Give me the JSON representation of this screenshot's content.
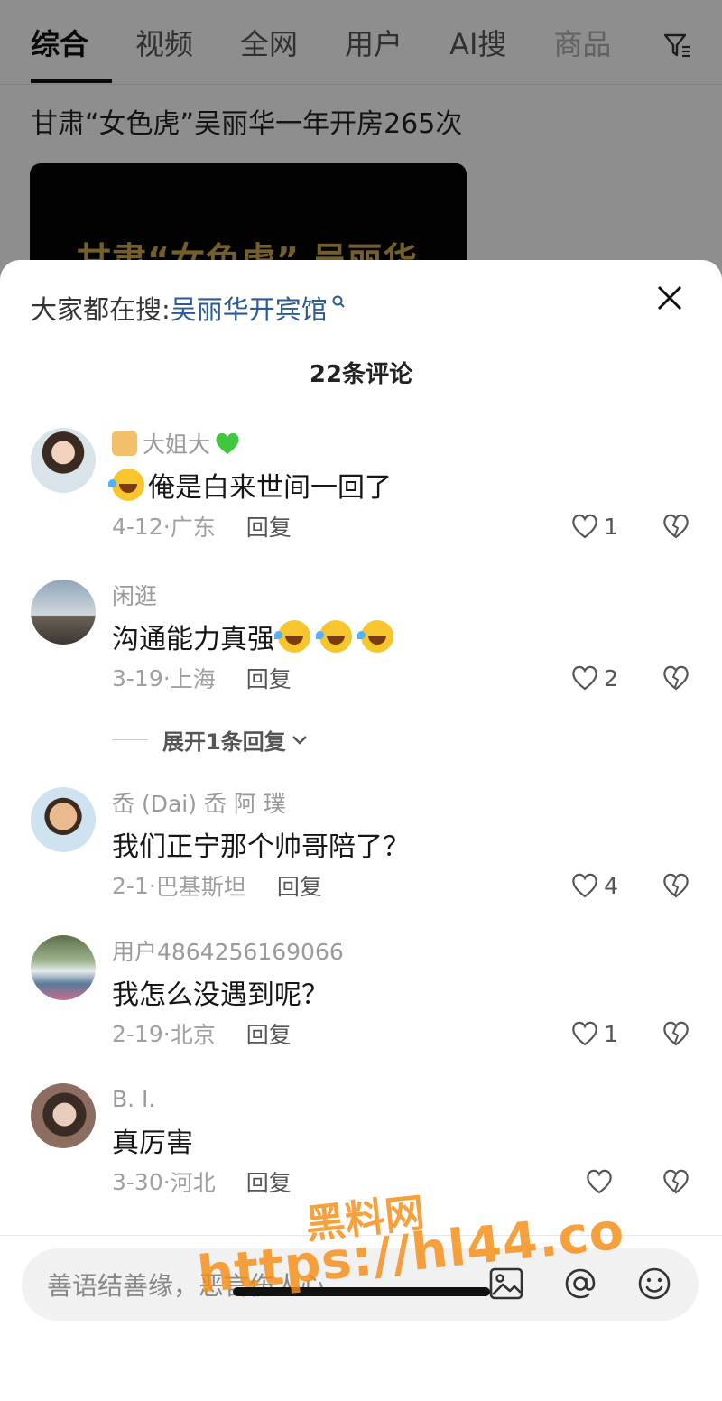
{
  "tabs": [
    {
      "label": "综合",
      "active": true
    },
    {
      "label": "视频"
    },
    {
      "label": "全网"
    },
    {
      "label": "用户"
    },
    {
      "label": "AI搜"
    },
    {
      "label": "商品"
    }
  ],
  "background": {
    "title": "甘肃“女色虎”吴丽华一年开房265次",
    "video_caption": "甘肃“女色虎” 吴丽华"
  },
  "sheet": {
    "trending_prefix": "大家都在搜:",
    "trending_query": "吴丽华开宾馆",
    "comment_count": "22条评论",
    "comments": [
      {
        "user": "大姐大",
        "text": "俺是白来世间一回了",
        "emoji_before": 1,
        "emoji_after": 0,
        "date": "4-12",
        "location": "广东",
        "reply": "回复",
        "likes": "1"
      },
      {
        "user": "闲逛",
        "text": "沟通能力真强",
        "emoji_before": 0,
        "emoji_after": 3,
        "date": "3-19",
        "location": "上海",
        "reply": "回复",
        "likes": "2"
      },
      {
        "user": "岙 (Dai)  岙   阿   璞",
        "text": "我们正宁那个帅哥陪了？",
        "emoji_before": 0,
        "emoji_after": 0,
        "date": "2-1",
        "location": "巴基斯坦",
        "reply": "回复",
        "likes": "4"
      },
      {
        "user": "用户4864256169066",
        "text": "我怎么没遇到呢？",
        "emoji_before": 0,
        "emoji_after": 0,
        "date": "2-19",
        "location": "北京",
        "reply": "回复",
        "likes": "1"
      },
      {
        "user": "B. I.",
        "text": "真厉害",
        "emoji_before": 0,
        "emoji_after": 0,
        "date": "3-30",
        "location": "河北",
        "reply": "回复",
        "likes": ""
      }
    ],
    "expand_replies": "展开1条回复"
  },
  "input": {
    "placeholder": "善语结善缘，恶言伤人心"
  },
  "watermark": {
    "line1": "黑料网",
    "line2": "https://hl44.co"
  },
  "colors": {
    "link": "#2c5a94",
    "watermark": "#f58c14"
  }
}
